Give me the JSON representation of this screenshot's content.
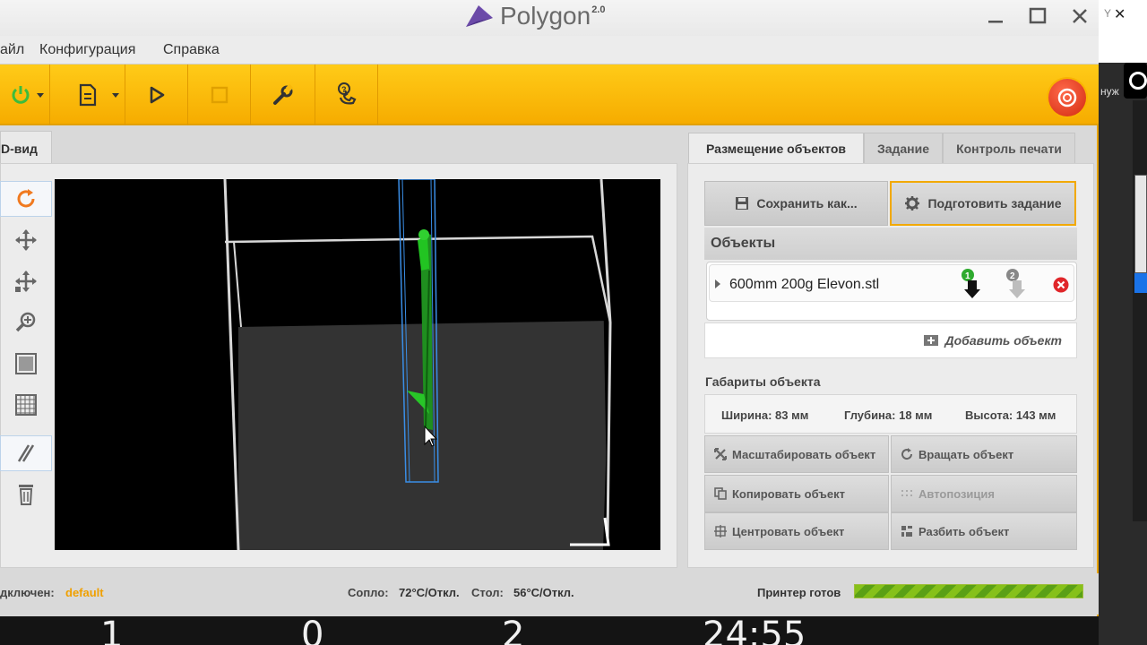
{
  "app": {
    "name": "Polygon",
    "version": "2.0"
  },
  "menu": {
    "file": "айл",
    "config": "Конфигурация",
    "help": "Справка"
  },
  "tabs_left": {
    "view3d": "D-вид"
  },
  "tabs_right": {
    "placement": "Размещение объектов",
    "task": "Задание",
    "print_control": "Контроль печати"
  },
  "actions": {
    "save_as": "Сохранить как...",
    "prepare_task": "Подготовить задание",
    "add_object": "Добавить объект"
  },
  "objects": {
    "header": "Объекты",
    "items": [
      {
        "name": "600mm 200g Elevon.stl",
        "badge1": "1",
        "badge2": "2"
      }
    ]
  },
  "dimensions": {
    "title": "Габариты объекта",
    "width": "Ширина: 83 мм",
    "depth": "Глубина: 18 мм",
    "height": "Высота: 143 мм"
  },
  "object_actions": {
    "scale": "Масштабировать объект",
    "rotate": "Вращать объект",
    "copy": "Копировать объект",
    "autopos": "Автопозиция",
    "center": "Центровать объект",
    "split": "Разбить объект"
  },
  "status": {
    "connected_label": "дключен:",
    "connected_value": "default",
    "nozzle_label": "Сопло:",
    "nozzle_value": "72°C/Откл.",
    "bed_label": "Стол:",
    "bed_value": "56°C/Откл.",
    "printer_ready": "Принтер готов",
    "progress": 1.0
  },
  "overlay_numbers": [
    "1",
    "0",
    "2",
    "24:55"
  ],
  "side_right": {
    "close": "✕",
    "partial": "нуж"
  },
  "colors": {
    "toolbar": "#ffc20e",
    "accent": "#f2a900",
    "model": "#22b422",
    "selection": "#3a8ee6"
  }
}
